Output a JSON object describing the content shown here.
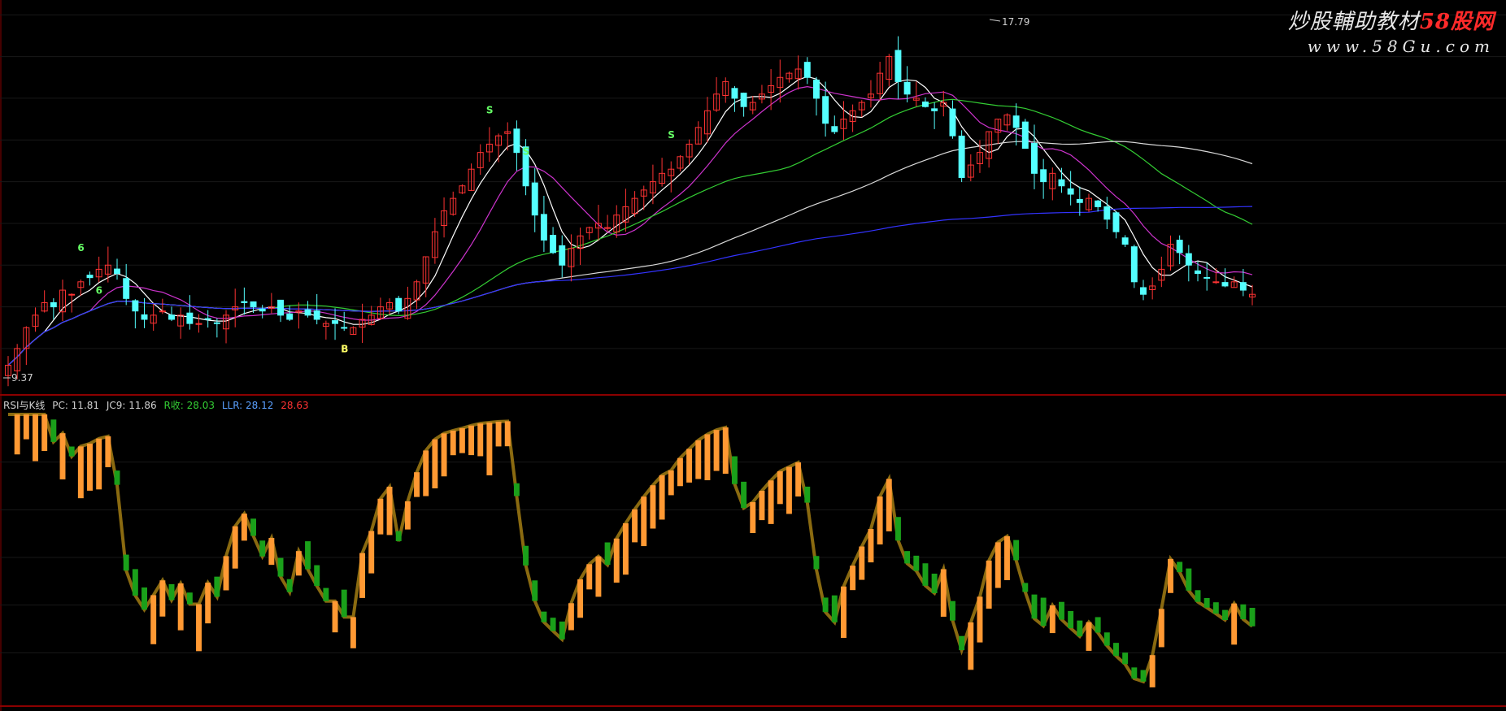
{
  "watermark": {
    "title_prefix": "炒股輔助教材",
    "title_brand": "58股网",
    "url": "www.58Gu.com"
  },
  "colors": {
    "up": "#ff3333",
    "down": "#54ffff",
    "ma_white": "#ffffff",
    "ma_magenta": "#cc33cc",
    "ma_green": "#33cc33",
    "ma_grey": "#d8d8d8",
    "ma_blue": "#3333ff",
    "panel_border": "#8b0000",
    "rsi_orange": "#ff9933",
    "rsi_green": "#1aa01a",
    "rsi_olive": "#8a6a10"
  },
  "price_panel": {
    "high_label": "17.79",
    "low_label": "9.37",
    "buy_signal": "B",
    "sell_signal": "S",
    "num_signal": "6"
  },
  "indicator_panel": {
    "name": "RSI与K线",
    "pc": "PC: 11.81",
    "jc9": "JC9: 11.86",
    "rsi": "R收: 28.03",
    "llr": "LLR: 28.12",
    "last": "28.63"
  },
  "chart_data": {
    "type": "candlestick",
    "price_range": [
      9.37,
      17.79
    ],
    "close": [
      9.6,
      10.0,
      10.5,
      10.8,
      11.1,
      11.0,
      11.4,
      11.3,
      11.6,
      11.7,
      11.9,
      12.0,
      11.8,
      11.2,
      10.9,
      10.7,
      10.8,
      10.9,
      10.7,
      10.8,
      10.6,
      10.6,
      10.7,
      10.6,
      10.8,
      11.0,
      11.1,
      11.0,
      10.9,
      11.0,
      10.8,
      10.7,
      10.9,
      10.8,
      10.7,
      10.6,
      10.6,
      10.5,
      10.5,
      10.7,
      10.8,
      11.0,
      11.1,
      10.9,
      11.2,
      11.6,
      12.2,
      12.8,
      13.3,
      13.6,
      13.9,
      14.3,
      14.7,
      14.9,
      15.1,
      15.2,
      14.7,
      13.9,
      13.2,
      12.6,
      12.3,
      12.0,
      12.4,
      12.7,
      12.9,
      13.0,
      12.9,
      13.2,
      13.4,
      13.6,
      13.8,
      14.0,
      14.2,
      14.3,
      14.6,
      14.9,
      15.3,
      15.7,
      16.1,
      16.4,
      16.0,
      15.8,
      15.9,
      16.1,
      16.3,
      16.5,
      16.6,
      16.7,
      16.5,
      16.0,
      15.4,
      15.2,
      15.5,
      15.7,
      15.9,
      16.1,
      16.6,
      17.0,
      16.4,
      16.1,
      16.0,
      15.8,
      15.7,
      15.9,
      15.1,
      14.1,
      14.4,
      14.7,
      15.2,
      15.5,
      15.6,
      15.3,
      14.8,
      14.2,
      14.0,
      14.2,
      13.9,
      13.7,
      13.5,
      13.6,
      13.4,
      13.1,
      12.8,
      12.5,
      11.6,
      11.3,
      11.5,
      11.9,
      12.5,
      12.3,
      12.0,
      11.8,
      11.7,
      11.6,
      11.5,
      11.6,
      11.4,
      11.3
    ],
    "up_color_scheme": "red-up/cyan-down",
    "moving_averages": [
      "MA5 (white)",
      "MA10 (magenta)",
      "MA30 (green)",
      "MA60 (grey)",
      "MA120 (blue)"
    ]
  }
}
